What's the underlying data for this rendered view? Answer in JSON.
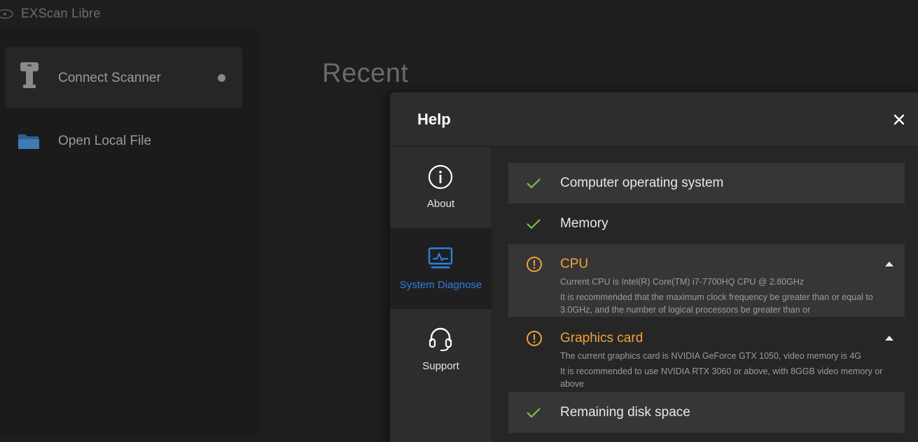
{
  "app": {
    "title": "EXScan Libre",
    "logo_icon": "exscan-logo"
  },
  "sidebar": {
    "connect_scanner": {
      "label": "Connect Scanner",
      "icon": "scanner-icon",
      "status": "disconnected"
    },
    "open_local_file": {
      "label": "Open Local File",
      "icon": "folder-icon"
    }
  },
  "main": {
    "recent_title": "Recent"
  },
  "help_dialog": {
    "title": "Help",
    "close_icon": "close-icon",
    "tabs": [
      {
        "label": "About",
        "icon": "info-icon",
        "active": false
      },
      {
        "label": "System Diagnose",
        "icon": "monitor-icon",
        "active": true
      },
      {
        "label": "Support",
        "icon": "headset-icon",
        "active": false
      }
    ],
    "checks": [
      {
        "title": "Computer operating system",
        "status": "pass"
      },
      {
        "title": "Memory",
        "status": "pass"
      },
      {
        "title": "CPU",
        "status": "warning",
        "expanded": true,
        "current": "Current CPU is Intel(R) Core(TM) i7-7700HQ CPU @ 2.80GHz",
        "recommendation": "It is recommended that the maximum clock frequency be greater than or equal to 3.0GHz, and the number of logical processors be greater than or"
      },
      {
        "title": "Graphics card",
        "status": "warning",
        "expanded": true,
        "current": "The current graphics card is NVIDIA GeForce GTX 1050, video memory is 4G",
        "recommendation": "It is recommended to use NVIDIA RTX 3060 or above, with 8GGB video memory or above"
      },
      {
        "title": "Remaining disk space",
        "status": "pass"
      }
    ]
  },
  "colors": {
    "background": "#1e1e1e",
    "dialog": "#2d2d2d",
    "pass_green": "#7cc142",
    "warning_orange": "#f1a437",
    "active_blue": "#2f7fe0"
  }
}
